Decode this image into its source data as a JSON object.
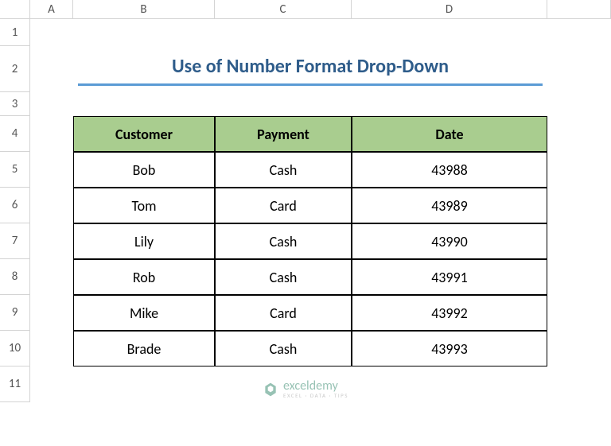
{
  "columns": [
    "",
    "A",
    "B",
    "C",
    "D",
    ""
  ],
  "rows": [
    "1",
    "2",
    "3",
    "4",
    "5",
    "6",
    "7",
    "8",
    "9",
    "10",
    "11"
  ],
  "title": "Use of Number Format Drop-Down",
  "table": {
    "headers": [
      "Customer",
      "Payment",
      "Date"
    ],
    "data": [
      [
        "Bob",
        "Cash",
        "43988"
      ],
      [
        "Tom",
        "Card",
        "43989"
      ],
      [
        "Lily",
        "Cash",
        "43990"
      ],
      [
        "Rob",
        "Cash",
        "43991"
      ],
      [
        "Mike",
        "Card",
        "43992"
      ],
      [
        "Brade",
        "Cash",
        "43993"
      ]
    ]
  },
  "watermark": {
    "brand": "exceldemy",
    "tagline": "EXCEL · DATA · TIPS"
  },
  "chart_data": {
    "type": "table",
    "title": "Use of Number Format Drop-Down",
    "headers": [
      "Customer",
      "Payment",
      "Date"
    ],
    "rows": [
      {
        "Customer": "Bob",
        "Payment": "Cash",
        "Date": 43988
      },
      {
        "Customer": "Tom",
        "Payment": "Card",
        "Date": 43989
      },
      {
        "Customer": "Lily",
        "Payment": "Cash",
        "Date": 43990
      },
      {
        "Customer": "Rob",
        "Payment": "Cash",
        "Date": 43991
      },
      {
        "Customer": "Mike",
        "Payment": "Card",
        "Date": 43992
      },
      {
        "Customer": "Brade",
        "Payment": "Cash",
        "Date": 43993
      }
    ]
  }
}
